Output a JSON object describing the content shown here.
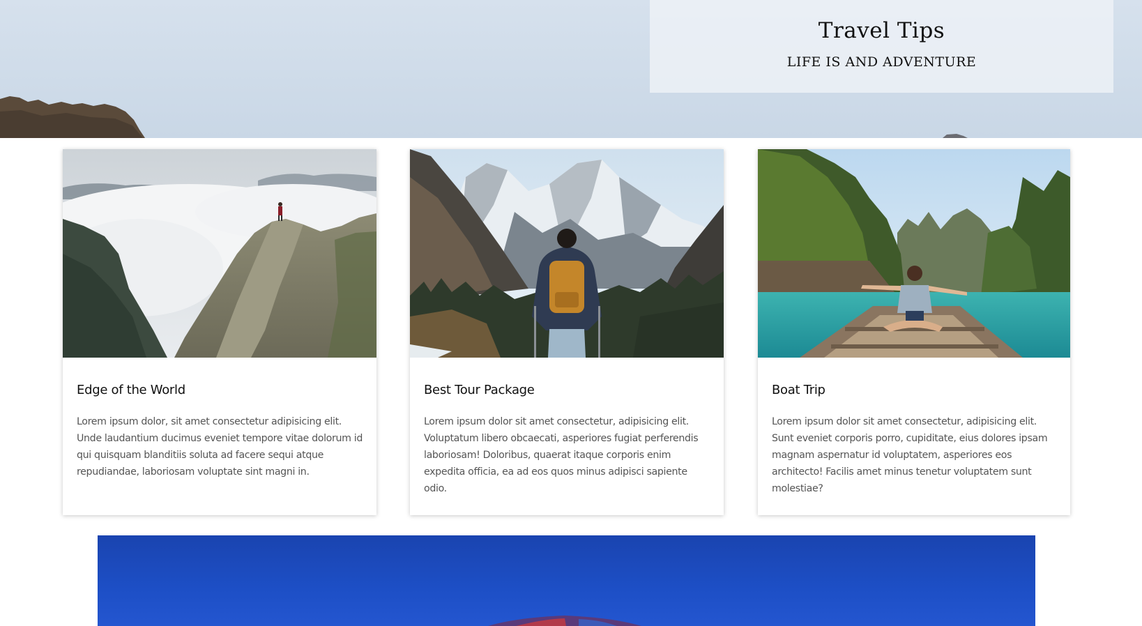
{
  "header": {
    "title": "Travel Tips",
    "tagline": "LIFE IS AND ADVENTURE"
  },
  "cards": [
    {
      "title": "Edge of the World",
      "text": "Lorem ipsum dolor, sit amet consectetur adipisicing elit. Unde laudantium ducimus eveniet tempore vitae dolorum id qui quisquam blanditiis soluta ad facere sequi atque repudiandae, laboriosam voluptate sint magni in.",
      "image_alt": "hiker on cliff above clouds"
    },
    {
      "title": "Best Tour Package",
      "text": "Lorem ipsum dolor sit amet consectetur, adipisicing elit. Voluptatum libero obcaecati, asperiores fugiat perferendis laboriosam! Doloribus, quaerat itaque corporis enim expedita officia, ea ad eos quos minus adipisci sapiente odio.",
      "image_alt": "hiker with backpack facing snowy mountains"
    },
    {
      "title": "Boat Trip",
      "text": "Lorem ipsum dolor sit amet consectetur, adipisicing elit. Sunt eveniet corporis porro, cupiditate, eius dolores ipsam magnam aspernatur id voluptatem, asperiores eos architecto! Facilis amet minus tenetur voluptatem sunt molestiae?",
      "image_alt": "woman sitting on boat in turquoise lagoon"
    }
  ],
  "colors": {
    "sky": "#d3deea",
    "banner_blue": "#1d4fc6",
    "text_dark": "#111111",
    "text_body": "#555555"
  }
}
